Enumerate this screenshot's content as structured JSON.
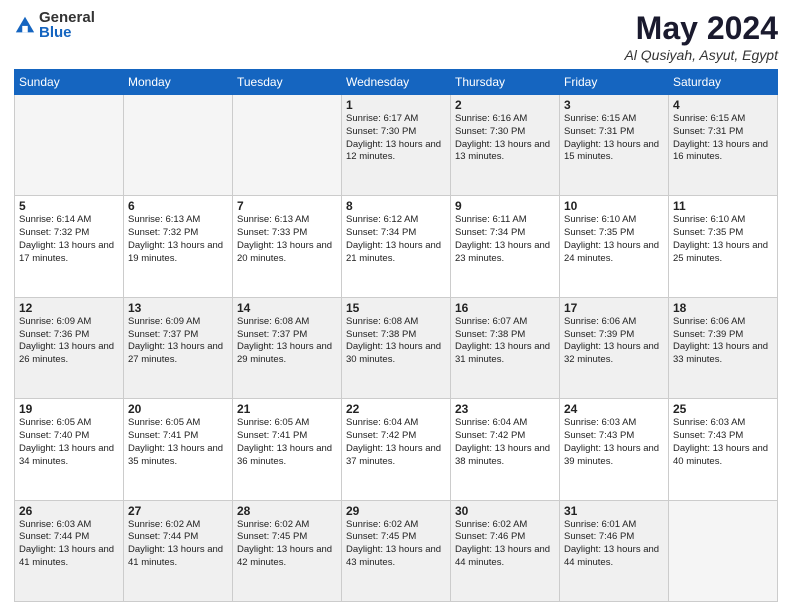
{
  "header": {
    "logo_general": "General",
    "logo_blue": "Blue",
    "month_title": "May 2024",
    "location": "Al Qusiyah, Asyut, Egypt"
  },
  "weekdays": [
    "Sunday",
    "Monday",
    "Tuesday",
    "Wednesday",
    "Thursday",
    "Friday",
    "Saturday"
  ],
  "weeks": [
    [
      {
        "day": "",
        "info": ""
      },
      {
        "day": "",
        "info": ""
      },
      {
        "day": "",
        "info": ""
      },
      {
        "day": "1",
        "info": "Sunrise: 6:17 AM\nSunset: 7:30 PM\nDaylight: 13 hours\nand 12 minutes."
      },
      {
        "day": "2",
        "info": "Sunrise: 6:16 AM\nSunset: 7:30 PM\nDaylight: 13 hours\nand 13 minutes."
      },
      {
        "day": "3",
        "info": "Sunrise: 6:15 AM\nSunset: 7:31 PM\nDaylight: 13 hours\nand 15 minutes."
      },
      {
        "day": "4",
        "info": "Sunrise: 6:15 AM\nSunset: 7:31 PM\nDaylight: 13 hours\nand 16 minutes."
      }
    ],
    [
      {
        "day": "5",
        "info": "Sunrise: 6:14 AM\nSunset: 7:32 PM\nDaylight: 13 hours\nand 17 minutes."
      },
      {
        "day": "6",
        "info": "Sunrise: 6:13 AM\nSunset: 7:32 PM\nDaylight: 13 hours\nand 19 minutes."
      },
      {
        "day": "7",
        "info": "Sunrise: 6:13 AM\nSunset: 7:33 PM\nDaylight: 13 hours\nand 20 minutes."
      },
      {
        "day": "8",
        "info": "Sunrise: 6:12 AM\nSunset: 7:34 PM\nDaylight: 13 hours\nand 21 minutes."
      },
      {
        "day": "9",
        "info": "Sunrise: 6:11 AM\nSunset: 7:34 PM\nDaylight: 13 hours\nand 23 minutes."
      },
      {
        "day": "10",
        "info": "Sunrise: 6:10 AM\nSunset: 7:35 PM\nDaylight: 13 hours\nand 24 minutes."
      },
      {
        "day": "11",
        "info": "Sunrise: 6:10 AM\nSunset: 7:35 PM\nDaylight: 13 hours\nand 25 minutes."
      }
    ],
    [
      {
        "day": "12",
        "info": "Sunrise: 6:09 AM\nSunset: 7:36 PM\nDaylight: 13 hours\nand 26 minutes."
      },
      {
        "day": "13",
        "info": "Sunrise: 6:09 AM\nSunset: 7:37 PM\nDaylight: 13 hours\nand 27 minutes."
      },
      {
        "day": "14",
        "info": "Sunrise: 6:08 AM\nSunset: 7:37 PM\nDaylight: 13 hours\nand 29 minutes."
      },
      {
        "day": "15",
        "info": "Sunrise: 6:08 AM\nSunset: 7:38 PM\nDaylight: 13 hours\nand 30 minutes."
      },
      {
        "day": "16",
        "info": "Sunrise: 6:07 AM\nSunset: 7:38 PM\nDaylight: 13 hours\nand 31 minutes."
      },
      {
        "day": "17",
        "info": "Sunrise: 6:06 AM\nSunset: 7:39 PM\nDaylight: 13 hours\nand 32 minutes."
      },
      {
        "day": "18",
        "info": "Sunrise: 6:06 AM\nSunset: 7:39 PM\nDaylight: 13 hours\nand 33 minutes."
      }
    ],
    [
      {
        "day": "19",
        "info": "Sunrise: 6:05 AM\nSunset: 7:40 PM\nDaylight: 13 hours\nand 34 minutes."
      },
      {
        "day": "20",
        "info": "Sunrise: 6:05 AM\nSunset: 7:41 PM\nDaylight: 13 hours\nand 35 minutes."
      },
      {
        "day": "21",
        "info": "Sunrise: 6:05 AM\nSunset: 7:41 PM\nDaylight: 13 hours\nand 36 minutes."
      },
      {
        "day": "22",
        "info": "Sunrise: 6:04 AM\nSunset: 7:42 PM\nDaylight: 13 hours\nand 37 minutes."
      },
      {
        "day": "23",
        "info": "Sunrise: 6:04 AM\nSunset: 7:42 PM\nDaylight: 13 hours\nand 38 minutes."
      },
      {
        "day": "24",
        "info": "Sunrise: 6:03 AM\nSunset: 7:43 PM\nDaylight: 13 hours\nand 39 minutes."
      },
      {
        "day": "25",
        "info": "Sunrise: 6:03 AM\nSunset: 7:43 PM\nDaylight: 13 hours\nand 40 minutes."
      }
    ],
    [
      {
        "day": "26",
        "info": "Sunrise: 6:03 AM\nSunset: 7:44 PM\nDaylight: 13 hours\nand 41 minutes."
      },
      {
        "day": "27",
        "info": "Sunrise: 6:02 AM\nSunset: 7:44 PM\nDaylight: 13 hours\nand 41 minutes."
      },
      {
        "day": "28",
        "info": "Sunrise: 6:02 AM\nSunset: 7:45 PM\nDaylight: 13 hours\nand 42 minutes."
      },
      {
        "day": "29",
        "info": "Sunrise: 6:02 AM\nSunset: 7:45 PM\nDaylight: 13 hours\nand 43 minutes."
      },
      {
        "day": "30",
        "info": "Sunrise: 6:02 AM\nSunset: 7:46 PM\nDaylight: 13 hours\nand 44 minutes."
      },
      {
        "day": "31",
        "info": "Sunrise: 6:01 AM\nSunset: 7:46 PM\nDaylight: 13 hours\nand 44 minutes."
      },
      {
        "day": "",
        "info": ""
      }
    ]
  ]
}
